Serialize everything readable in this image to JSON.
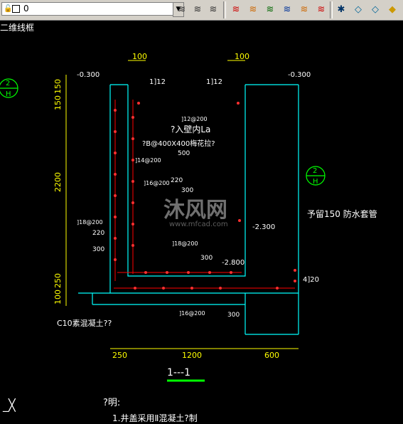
{
  "toolbar": {
    "layer_value": "0",
    "icons": [
      "layer-state-icon",
      "layer-previous-icon",
      "layer-match-icon",
      "layer-off-icon",
      "layer-isolate-icon",
      "layer-freeze-icon",
      "layer-lock-icon",
      "layer-unlock-icon",
      "layer-merge-icon",
      "layer-delete-icon",
      "layer-walk-icon",
      "layer-change-icon",
      "layer-copy-icon",
      "layer-erase-icon"
    ]
  },
  "viewport": {
    "view_label": "二维线框"
  },
  "drawing": {
    "dims_top": [
      "100",
      "100"
    ],
    "elev_left": "-0.300",
    "elev_right": "-0.300",
    "vert_dims": [
      "150",
      "150",
      "2200",
      "250",
      "100"
    ],
    "bottom_dims": [
      "250",
      "1200",
      "600"
    ],
    "rebar_12_left": "1]12",
    "rebar_12_right": "1]12",
    "rebar_top": "]12@200",
    "wall_note": "?入壁内La",
    "haunch_note": "?B@400X400梅花拉?",
    "r500": "500",
    "r14": "]14@200",
    "r220a": "220",
    "r16": "]16@200",
    "r300a": "300",
    "r18": "]18@200",
    "r220b": "220",
    "r300b": "300",
    "r18b": "]18@200",
    "r300c": "300",
    "r16b": "]16@200",
    "r300d": "300",
    "elev_mid1": "-2.300",
    "elev_mid2": "-2.800",
    "pipe_note": "予留150 防水套管",
    "r420": "4]20",
    "c10": "C10素混凝土??",
    "section_label": "1---1",
    "section_2h_a": "2",
    "section_2h_b": "H",
    "notes_title": "?明:",
    "notes_line1": "1.井盖采用Ⅱ混凝土?制",
    "watermark_cn": "沐风网",
    "watermark_url": "www.mfcad.com"
  }
}
